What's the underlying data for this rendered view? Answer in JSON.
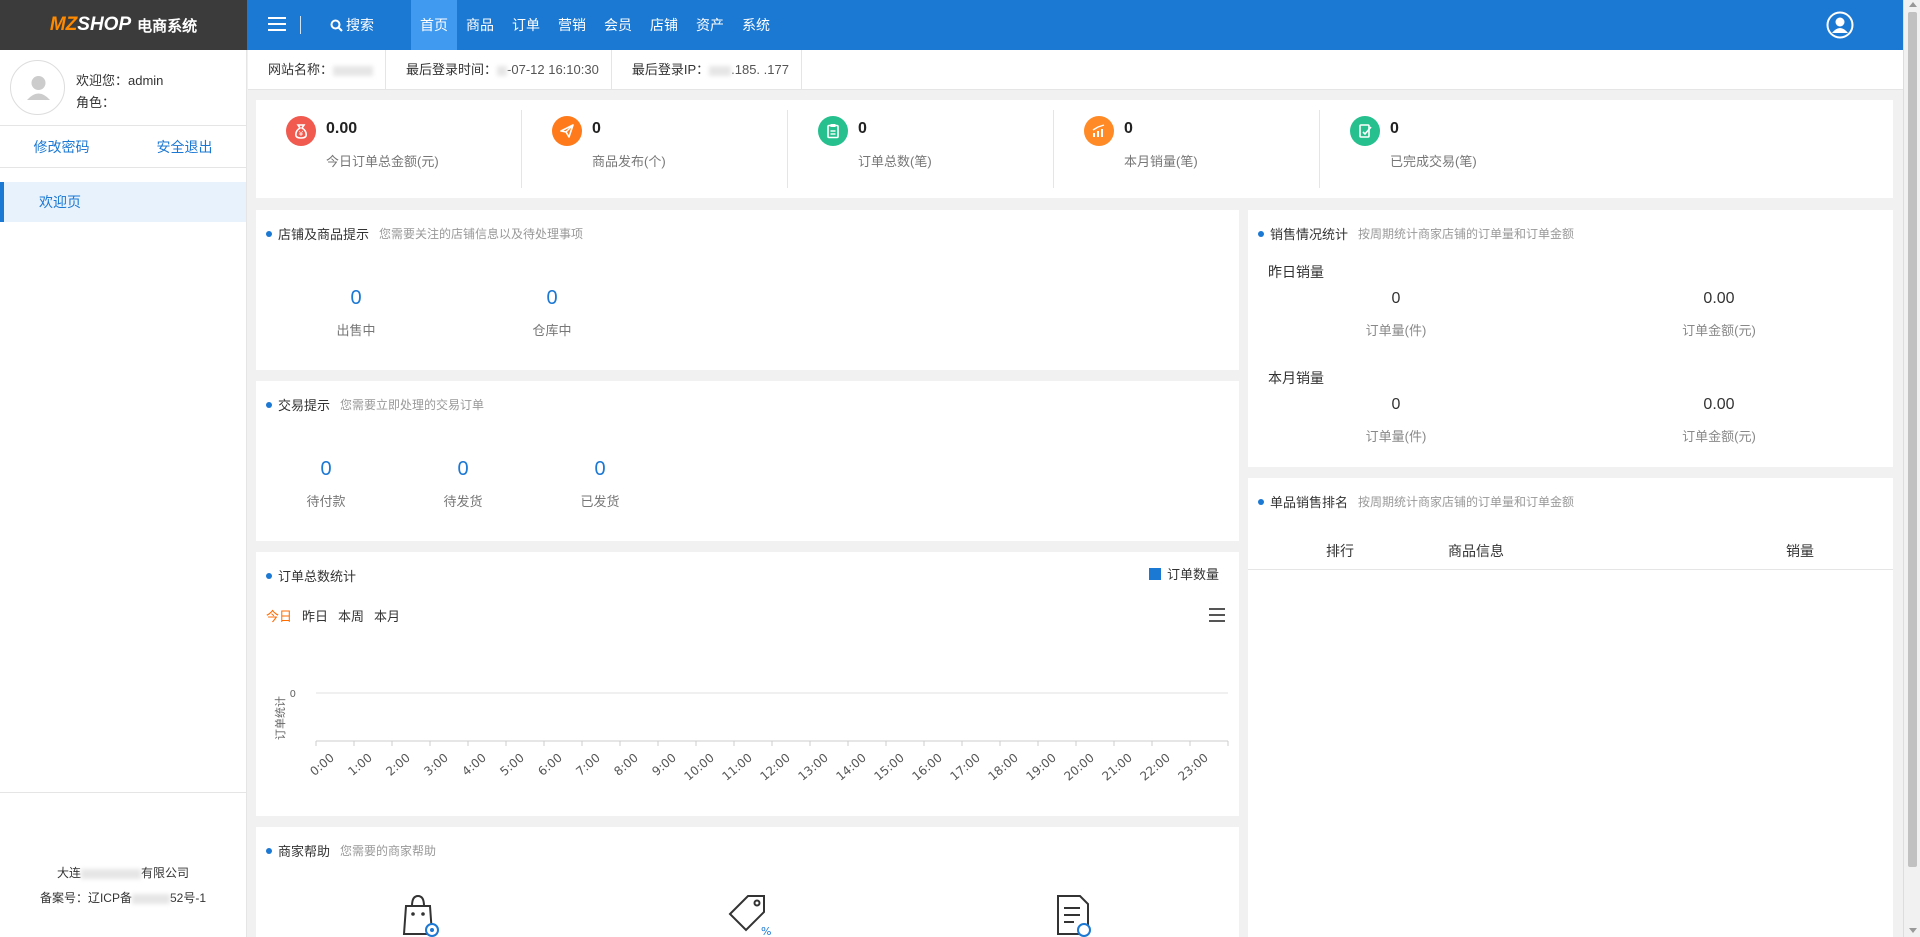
{
  "header": {
    "logo_mz": "MZ",
    "logo_shop": "SHOP",
    "logo_sys": "电商系统",
    "search_label": "搜索",
    "nav": [
      "首页",
      "商品",
      "订单",
      "营销",
      "会员",
      "店铺",
      "资产",
      "系统"
    ],
    "active_nav": "首页"
  },
  "sidebar": {
    "welcome_label": "欢迎您：admin",
    "role_label": "角色：",
    "change_password": "修改密码",
    "logout": "安全退出",
    "menu": [
      "欢迎页"
    ],
    "company": "大连",
    "company_suffix": "有限公司",
    "icp": "备案号：辽ICP备",
    "icp_suffix": "52号-1"
  },
  "infobar": {
    "site_name_label": "网站名称：",
    "site_name_value": "",
    "last_login_label": "最后登录时间：",
    "last_login_value": "-07-12 16:10:30",
    "last_ip_label": "最后登录IP：",
    "last_ip_value": ".185.   .177"
  },
  "stats": [
    {
      "value": "0.00",
      "label": "今日订单总金额(元)",
      "color": "#f05a4f",
      "icon": "money-bag-icon"
    },
    {
      "value": "0",
      "label": "商品发布(个)",
      "color": "#ff7a1a",
      "icon": "paper-plane-icon"
    },
    {
      "value": "0",
      "label": "订单总数(笔)",
      "color": "#26c08f",
      "icon": "clipboard-icon"
    },
    {
      "value": "0",
      "label": "本月销量(笔)",
      "color": "#ff8a26",
      "icon": "bar-chart-icon"
    },
    {
      "value": "0",
      "label": "已完成交易(笔)",
      "color": "#26c08f",
      "icon": "document-check-icon"
    }
  ],
  "shop_panel": {
    "title": "店铺及商品提示",
    "subtitle": "您需要关注的店铺信息以及待处理事项",
    "items": [
      {
        "value": "0",
        "label": "出售中"
      },
      {
        "value": "0",
        "label": "仓库中"
      }
    ]
  },
  "trade_panel": {
    "title": "交易提示",
    "subtitle": "您需要立即处理的交易订单",
    "items": [
      {
        "value": "0",
        "label": "待付款"
      },
      {
        "value": "0",
        "label": "待发货"
      },
      {
        "value": "0",
        "label": "已发货"
      }
    ]
  },
  "order_chart": {
    "title": "订单总数统计",
    "legend": "订单数量",
    "ranges": [
      "今日",
      "昨日",
      "本周",
      "本月"
    ],
    "active_range": "今日"
  },
  "chart_data": {
    "type": "bar",
    "title": "",
    "ylabel": "订单统计",
    "xlabel": "",
    "categories": [
      "0:00",
      "1:00",
      "2:00",
      "3:00",
      "4:00",
      "5:00",
      "6:00",
      "7:00",
      "8:00",
      "9:00",
      "10:00",
      "11:00",
      "12:00",
      "13:00",
      "14:00",
      "15:00",
      "16:00",
      "17:00",
      "18:00",
      "19:00",
      "20:00",
      "21:00",
      "22:00",
      "23:00"
    ],
    "series": [
      {
        "name": "订单数量",
        "values": [
          0,
          0,
          0,
          0,
          0,
          0,
          0,
          0,
          0,
          0,
          0,
          0,
          0,
          0,
          0,
          0,
          0,
          0,
          0,
          0,
          0,
          0,
          0,
          0
        ]
      }
    ],
    "yticks": [
      "0"
    ],
    "grid": true,
    "legend": "top-right"
  },
  "help_panel": {
    "title": "商家帮助",
    "subtitle": "您需要的商家帮助",
    "icons": [
      "shopping-bag-gear-icon",
      "price-tag-icon",
      "document-refresh-icon"
    ]
  },
  "sales_panel": {
    "title": "销售情况统计",
    "subtitle": "按周期统计商家店铺的订单量和订单金额",
    "yesterday_title": "昨日销量",
    "month_title": "本月销量",
    "yesterday": [
      {
        "value": "0",
        "label": "订单量(件)"
      },
      {
        "value": "0.00",
        "label": "订单金额(元)"
      }
    ],
    "month": [
      {
        "value": "0",
        "label": "订单量(件)"
      },
      {
        "value": "0.00",
        "label": "订单金额(元)"
      }
    ]
  },
  "ranking_panel": {
    "title": "单品销售排名",
    "subtitle": "按周期统计商家店铺的订单量和订单金额",
    "headers": [
      "排行",
      "商品信息",
      "销量"
    ]
  }
}
